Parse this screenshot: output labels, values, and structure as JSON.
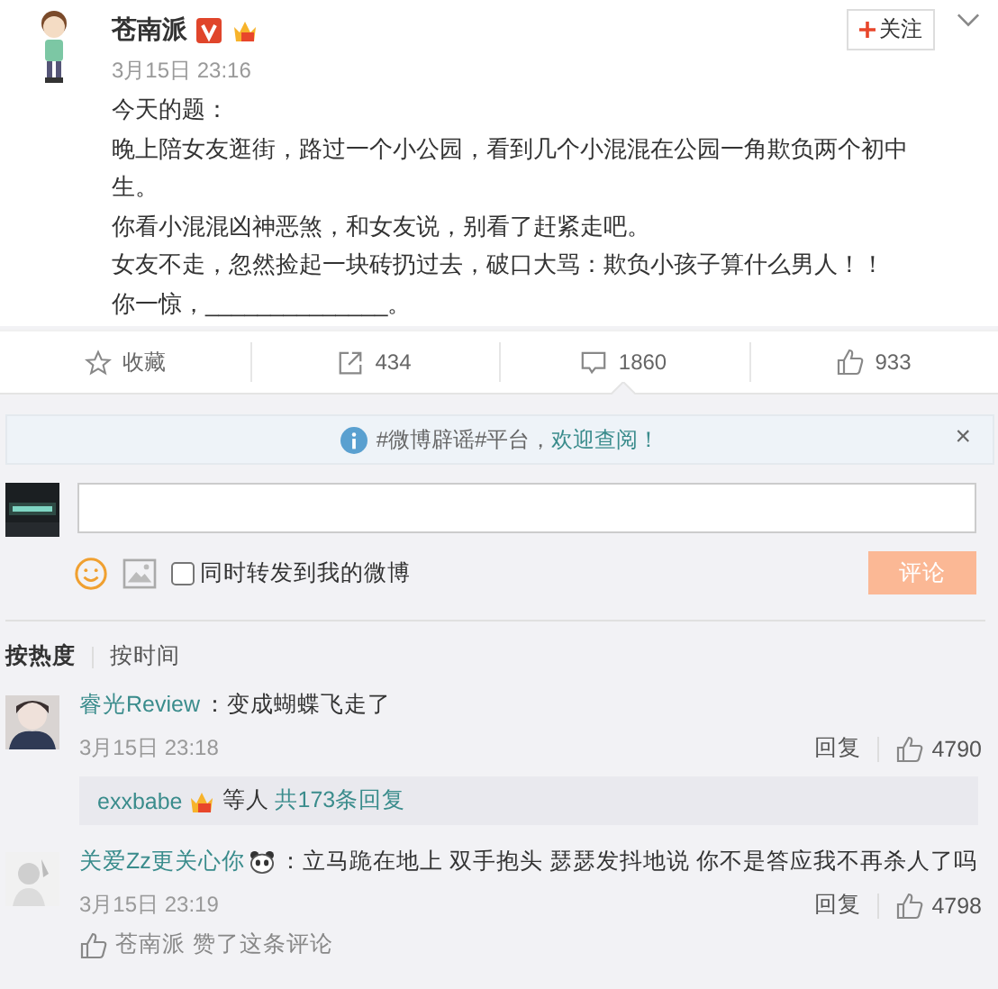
{
  "post": {
    "author": "苍南派",
    "date": "3月15日 23:16",
    "follow": "关注",
    "lines": [
      "今天的题：",
      "晚上陪女友逛街，路过一个小公园，看到几个小混混在公园一角欺负两个初中生。",
      "你看小混混凶神恶煞，和女友说，别看了赶紧走吧。",
      "女友不走，忽然捡起一块砖扔过去，破口大骂：欺负小孩子算什么男人！！",
      "你一惊，______________。"
    ]
  },
  "actions": [
    {
      "kind": "favorite",
      "label": "收藏",
      "selected": false
    },
    {
      "kind": "repost",
      "label": "434",
      "selected": false
    },
    {
      "kind": "comment",
      "label": "1860",
      "selected": true
    },
    {
      "kind": "like",
      "label": "933",
      "selected": false
    }
  ],
  "notice": {
    "text": "#微博辟谣#平台，",
    "link": "欢迎查阅！",
    "close": "×"
  },
  "composer": {
    "repost_label": "同时转发到我的微博",
    "repost_checked": false,
    "submit": "评论"
  },
  "sort": [
    {
      "label": "按热度",
      "selected": true
    },
    {
      "label": "按时间",
      "selected": false
    }
  ],
  "comments": [
    {
      "user": "睿光Review",
      "text": "：变成蝴蝶飞走了",
      "date": "3月15日 23:18",
      "reply": "回复",
      "likes": "4790",
      "replies": {
        "user": "exxbabe",
        "middle": "等人",
        "count": "共173条回复"
      }
    },
    {
      "user": "关爱Zz更关心你",
      "emoji": true,
      "text": "：立马跪在地上 双手抱头 瑟瑟发抖地说 你不是答应我不再杀人了吗",
      "date": "3月15日 23:19",
      "reply": "回复",
      "likes": "4798",
      "liked_by": {
        "user": "苍南派",
        "text": "赞了这条评论"
      }
    }
  ]
}
